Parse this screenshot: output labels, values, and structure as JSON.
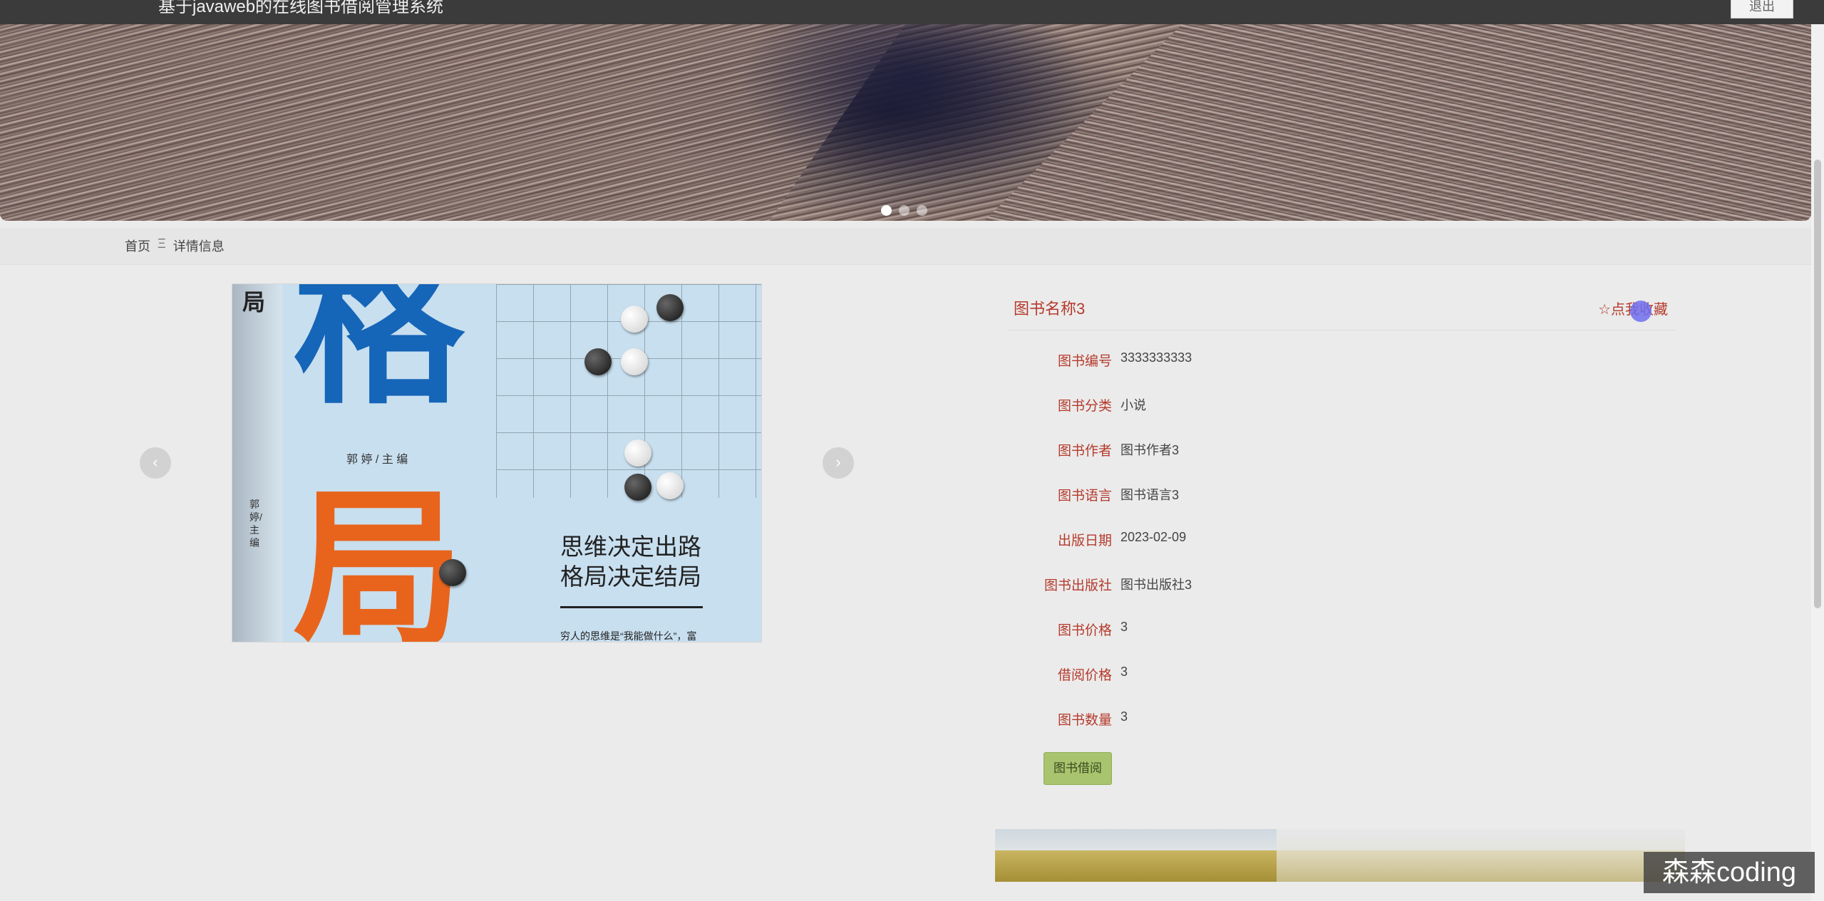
{
  "header": {
    "app_title": "基于javaweb的在线图书借阅管理系统",
    "logout_label": "退出"
  },
  "banner": {
    "slides": 3,
    "active_slide": 1
  },
  "breadcrumb": {
    "home": "首页",
    "separator": "Ξ",
    "current": "详情信息"
  },
  "gallery": {
    "prev_icon": "‹",
    "next_icon": "›",
    "cover": {
      "title_char_top": "格",
      "title_char_bottom": "局",
      "corner_char": "局",
      "editor": "郭 婷 / 主 编",
      "spine_text": "郭婷/主编",
      "slogan_line1": "思维决定出路",
      "slogan_line2": "格局决定结局",
      "small_text": "穷人的思维是“我能做什么”，富"
    }
  },
  "detail": {
    "book_name": "图书名称3",
    "favorite_label": "☆点我收藏",
    "fields": [
      {
        "label": "图书编号",
        "value": "3333333333"
      },
      {
        "label": "图书分类",
        "value": "小说"
      },
      {
        "label": "图书作者",
        "value": "图书作者3"
      },
      {
        "label": "图书语言",
        "value": "图书语言3"
      },
      {
        "label": "出版日期",
        "value": "2023-02-09"
      },
      {
        "label": "图书出版社",
        "value": "图书出版社3"
      },
      {
        "label": "图书价格",
        "value": "3"
      },
      {
        "label": "借阅价格",
        "value": "3"
      },
      {
        "label": "图书数量",
        "value": "3"
      }
    ],
    "borrow_button": "图书借阅"
  },
  "watermark": "森森coding",
  "colors": {
    "topbar": "#3b3b3b",
    "accent_label": "#b53a2c",
    "borrow_button": "#a8c46e"
  }
}
